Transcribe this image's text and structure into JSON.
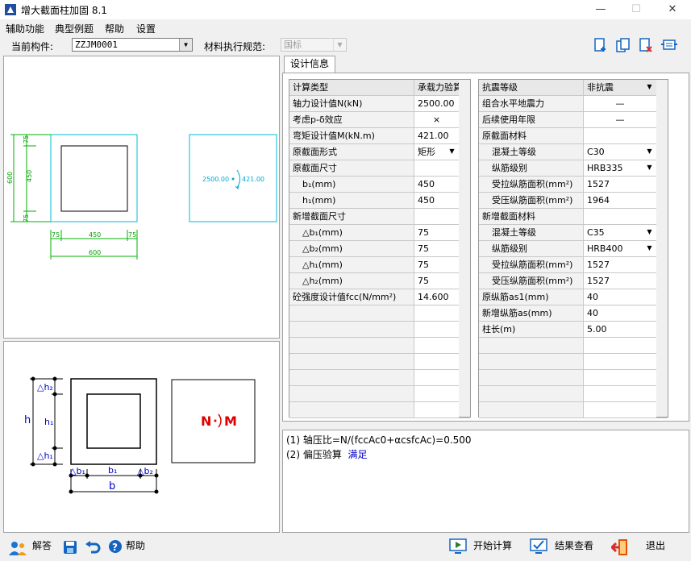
{
  "window": {
    "title": "增大截面柱加固 8.1",
    "min": "—",
    "max": "☐",
    "close": "✕"
  },
  "menu": [
    "辅助功能",
    "典型例题",
    "帮助",
    "设置"
  ],
  "component": {
    "label": "当前构件:",
    "value": "ZZJM0001",
    "spec_label": "材料执行规范:",
    "spec_value": "国标"
  },
  "tab": "设计信息",
  "left_table": [
    {
      "label": "计算类型",
      "value": "承载力验算",
      "header": true
    },
    {
      "label": "轴力设计值N(kN)",
      "value": "2500.00"
    },
    {
      "label": "考虑p-δ效应",
      "value": "×",
      "center": true
    },
    {
      "label": "弯矩设计值M(kN.m)",
      "value": "421.00"
    },
    {
      "label": "原截面形式",
      "value": "矩形",
      "dropdown": true
    },
    {
      "label": "原截面尺寸",
      "value": ""
    },
    {
      "label": "b₁(mm)",
      "value": "450",
      "indent": true
    },
    {
      "label": "h₁(mm)",
      "value": "450",
      "indent": true
    },
    {
      "label": "新增截面尺寸",
      "value": ""
    },
    {
      "label": "△b₁(mm)",
      "value": "75",
      "indent": true
    },
    {
      "label": "△b₂(mm)",
      "value": "75",
      "indent": true
    },
    {
      "label": "△h₁(mm)",
      "value": "75",
      "indent": true
    },
    {
      "label": "△h₂(mm)",
      "value": "75",
      "indent": true
    },
    {
      "label": "砼强度设计值fcc(N/mm²)",
      "value": "14.600"
    }
  ],
  "right_table": [
    {
      "label": "抗震等级",
      "value": "非抗震",
      "header": true,
      "dropdown": true
    },
    {
      "label": "组合水平地震力",
      "value": "—",
      "center": true
    },
    {
      "label": "后续使用年限",
      "value": "—",
      "center": true
    },
    {
      "label": "原截面材料",
      "value": ""
    },
    {
      "label": "混凝土等级",
      "value": "C30",
      "indent": true,
      "dropdown": true
    },
    {
      "label": "纵筋级别",
      "value": "HRB335",
      "indent": true,
      "dropdown": true
    },
    {
      "label": "受拉纵筋面积(mm²)",
      "value": "1527",
      "indent": true
    },
    {
      "label": "受压纵筋面积(mm²)",
      "value": "1964",
      "indent": true
    },
    {
      "label": "新增截面材料",
      "value": ""
    },
    {
      "label": "混凝土等级",
      "value": "C35",
      "indent": true,
      "dropdown": true
    },
    {
      "label": "纵筋级别",
      "value": "HRB400",
      "indent": true,
      "dropdown": true
    },
    {
      "label": "受拉纵筋面积(mm²)",
      "value": "1527",
      "indent": true
    },
    {
      "label": "受压纵筋面积(mm²)",
      "value": "1527",
      "indent": true
    },
    {
      "label": "原纵筋as1(mm)",
      "value": "40"
    },
    {
      "label": "新增纵筋as(mm)",
      "value": "40"
    },
    {
      "label": "柱长(m)",
      "value": "5.00"
    }
  ],
  "results": [
    {
      "text": "(1) 轴压比=N/(fccAc0+αcsfcAc)=0.500",
      "status": ""
    },
    {
      "text": "(2) 偏压验算",
      "status": "满足"
    }
  ],
  "drawing": {
    "dims_left": [
      "75",
      "450",
      "75",
      "600"
    ],
    "dims_bottom": [
      "75",
      "450",
      "75",
      "600"
    ],
    "load_n": "2500.00",
    "load_m": "421.00"
  },
  "schematic": {
    "labels_v": [
      "△h₂",
      "h",
      "h₁",
      "△h₁"
    ],
    "labels_h": [
      "△b₁",
      "b₁",
      "△b₂",
      "b"
    ],
    "nm_n": "N",
    "nm_m": "M"
  },
  "bottom": {
    "answer": "解答",
    "help": "帮助",
    "start": "开始计算",
    "view": "结果查看",
    "exit": "退出"
  },
  "colors": {
    "dim": "#00b000",
    "outline": "#00bcd4",
    "text_red": "#e00000",
    "status_blue": "#0000cc"
  }
}
